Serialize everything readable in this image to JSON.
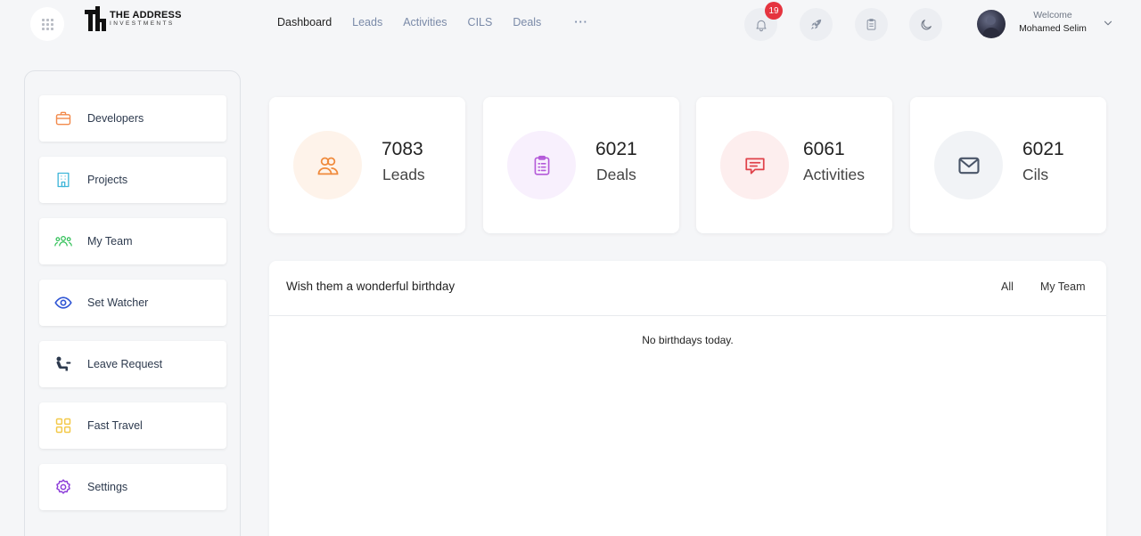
{
  "brand": {
    "title": "THE ADDRESS",
    "subtitle": "INVESTMENTS"
  },
  "nav": {
    "items": [
      "Dashboard",
      "Leads",
      "Activities",
      "CILS",
      "Deals"
    ],
    "active": "Dashboard",
    "more": "···"
  },
  "header": {
    "notification_count": "19",
    "welcome_label": "Welcome",
    "user_name": "Mohamed Selim"
  },
  "sidebar": {
    "items": [
      {
        "label": "Developers",
        "icon": "briefcase-icon",
        "color": "#f28a4b"
      },
      {
        "label": "Projects",
        "icon": "building-icon",
        "color": "#3fb6d9"
      },
      {
        "label": "My Team",
        "icon": "team-icon",
        "color": "#2fbf56"
      },
      {
        "label": "Set Watcher",
        "icon": "eye-icon",
        "color": "#2f55d4"
      },
      {
        "label": "Leave Request",
        "icon": "person-sitting-icon",
        "color": "#2d3a4e"
      },
      {
        "label": "Fast Travel",
        "icon": "grid-icon",
        "color": "#f3c94a"
      },
      {
        "label": "Settings",
        "icon": "gear-icon",
        "color": "#8e3fd9"
      }
    ]
  },
  "stats": [
    {
      "value": "7083",
      "label": "Leads",
      "icon": "users-icon",
      "color": "#f08a3c",
      "bg": "#fef3ea"
    },
    {
      "value": "6021",
      "label": "Deals",
      "icon": "clipboard-icon",
      "color": "#b45ad9",
      "bg": "#f8f0fd"
    },
    {
      "value": "6061",
      "label": "Activities",
      "icon": "chat-icon",
      "color": "#e0424a",
      "bg": "#fdeeee"
    },
    {
      "value": "6021",
      "label": "Cils",
      "icon": "mail-icon",
      "color": "#4a5568",
      "bg": "#f1f3f6"
    }
  ],
  "birthday": {
    "title": "Wish them a wonderful birthday",
    "filter_all": "All",
    "filter_team": "My Team",
    "empty": "No birthdays today."
  }
}
